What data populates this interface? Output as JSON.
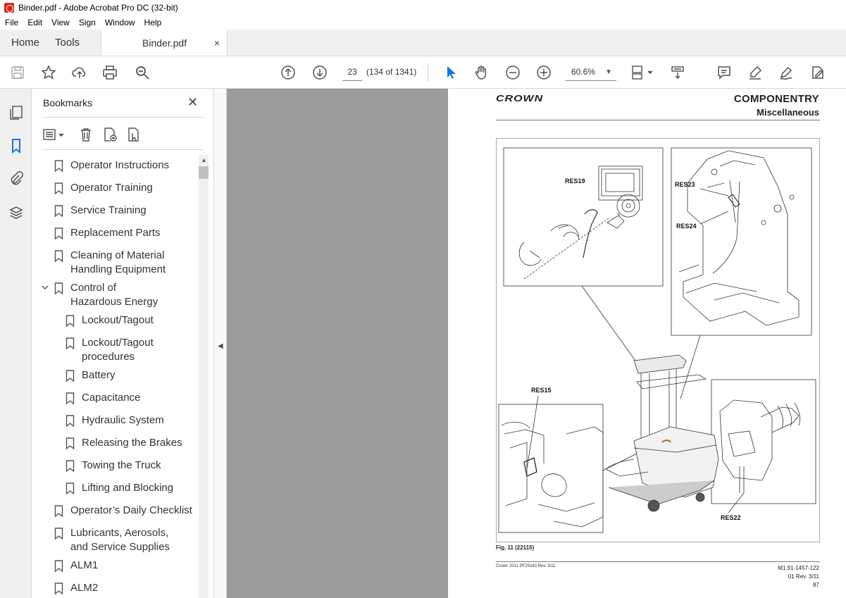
{
  "window": {
    "title": "Binder.pdf - Adobe Acrobat Pro DC (32-bit)"
  },
  "menu": [
    "File",
    "Edit",
    "View",
    "Sign",
    "Window",
    "Help"
  ],
  "tabs": {
    "home": "Home",
    "tools": "Tools",
    "document": "Binder.pdf",
    "close_symbol": "×"
  },
  "toolbar": {
    "page_number": "23",
    "page_count": "(134 of 1341)",
    "zoom": "60.6%"
  },
  "panel": {
    "title": "Bookmarks",
    "close_symbol": "✕",
    "items": [
      {
        "label": "Operator Instructions",
        "level": 0
      },
      {
        "label": "Operator Training",
        "level": 0
      },
      {
        "label": "Service Training",
        "level": 0
      },
      {
        "label": "Replacement Parts",
        "level": 0
      },
      {
        "label": "Cleaning of Material Handling Equipment",
        "level": 0
      },
      {
        "label": "Control of Hazardous Energy",
        "level": 0,
        "expanded": true
      },
      {
        "label": "Lockout/Tagout",
        "level": 1
      },
      {
        "label": "Lockout/Tagout procedures",
        "level": 1
      },
      {
        "label": "Battery",
        "level": 1
      },
      {
        "label": "Capacitance",
        "level": 1
      },
      {
        "label": "Hydraulic System",
        "level": 1
      },
      {
        "label": "Releasing the Brakes",
        "level": 1
      },
      {
        "label": "Towing the Truck",
        "level": 1
      },
      {
        "label": "Lifting and Blocking",
        "level": 1
      },
      {
        "label": "Operator’s Daily Checklist",
        "level": 0
      },
      {
        "label": "Lubricants, Aerosols, and Service Supplies",
        "level": 0
      },
      {
        "label": "ALM1",
        "level": 0
      },
      {
        "label": "ALM2",
        "level": 0
      }
    ]
  },
  "pdf_page": {
    "brand": "CROWN",
    "header_title": "COMPONENTRY",
    "header_subtitle": "Miscellaneous",
    "callouts": {
      "res19": "RES19",
      "res23": "RES23",
      "res24": "RES24",
      "res15": "RES15",
      "res22": "RES22"
    },
    "figure_caption": "Fig. 11 (22115)",
    "footer_left": "Crown 2011 PF25243 Rev. 3/11",
    "footer_right_1": "M1.91-1457-122",
    "footer_right_2": "01 Rev. 3/11",
    "page_number": "87"
  }
}
